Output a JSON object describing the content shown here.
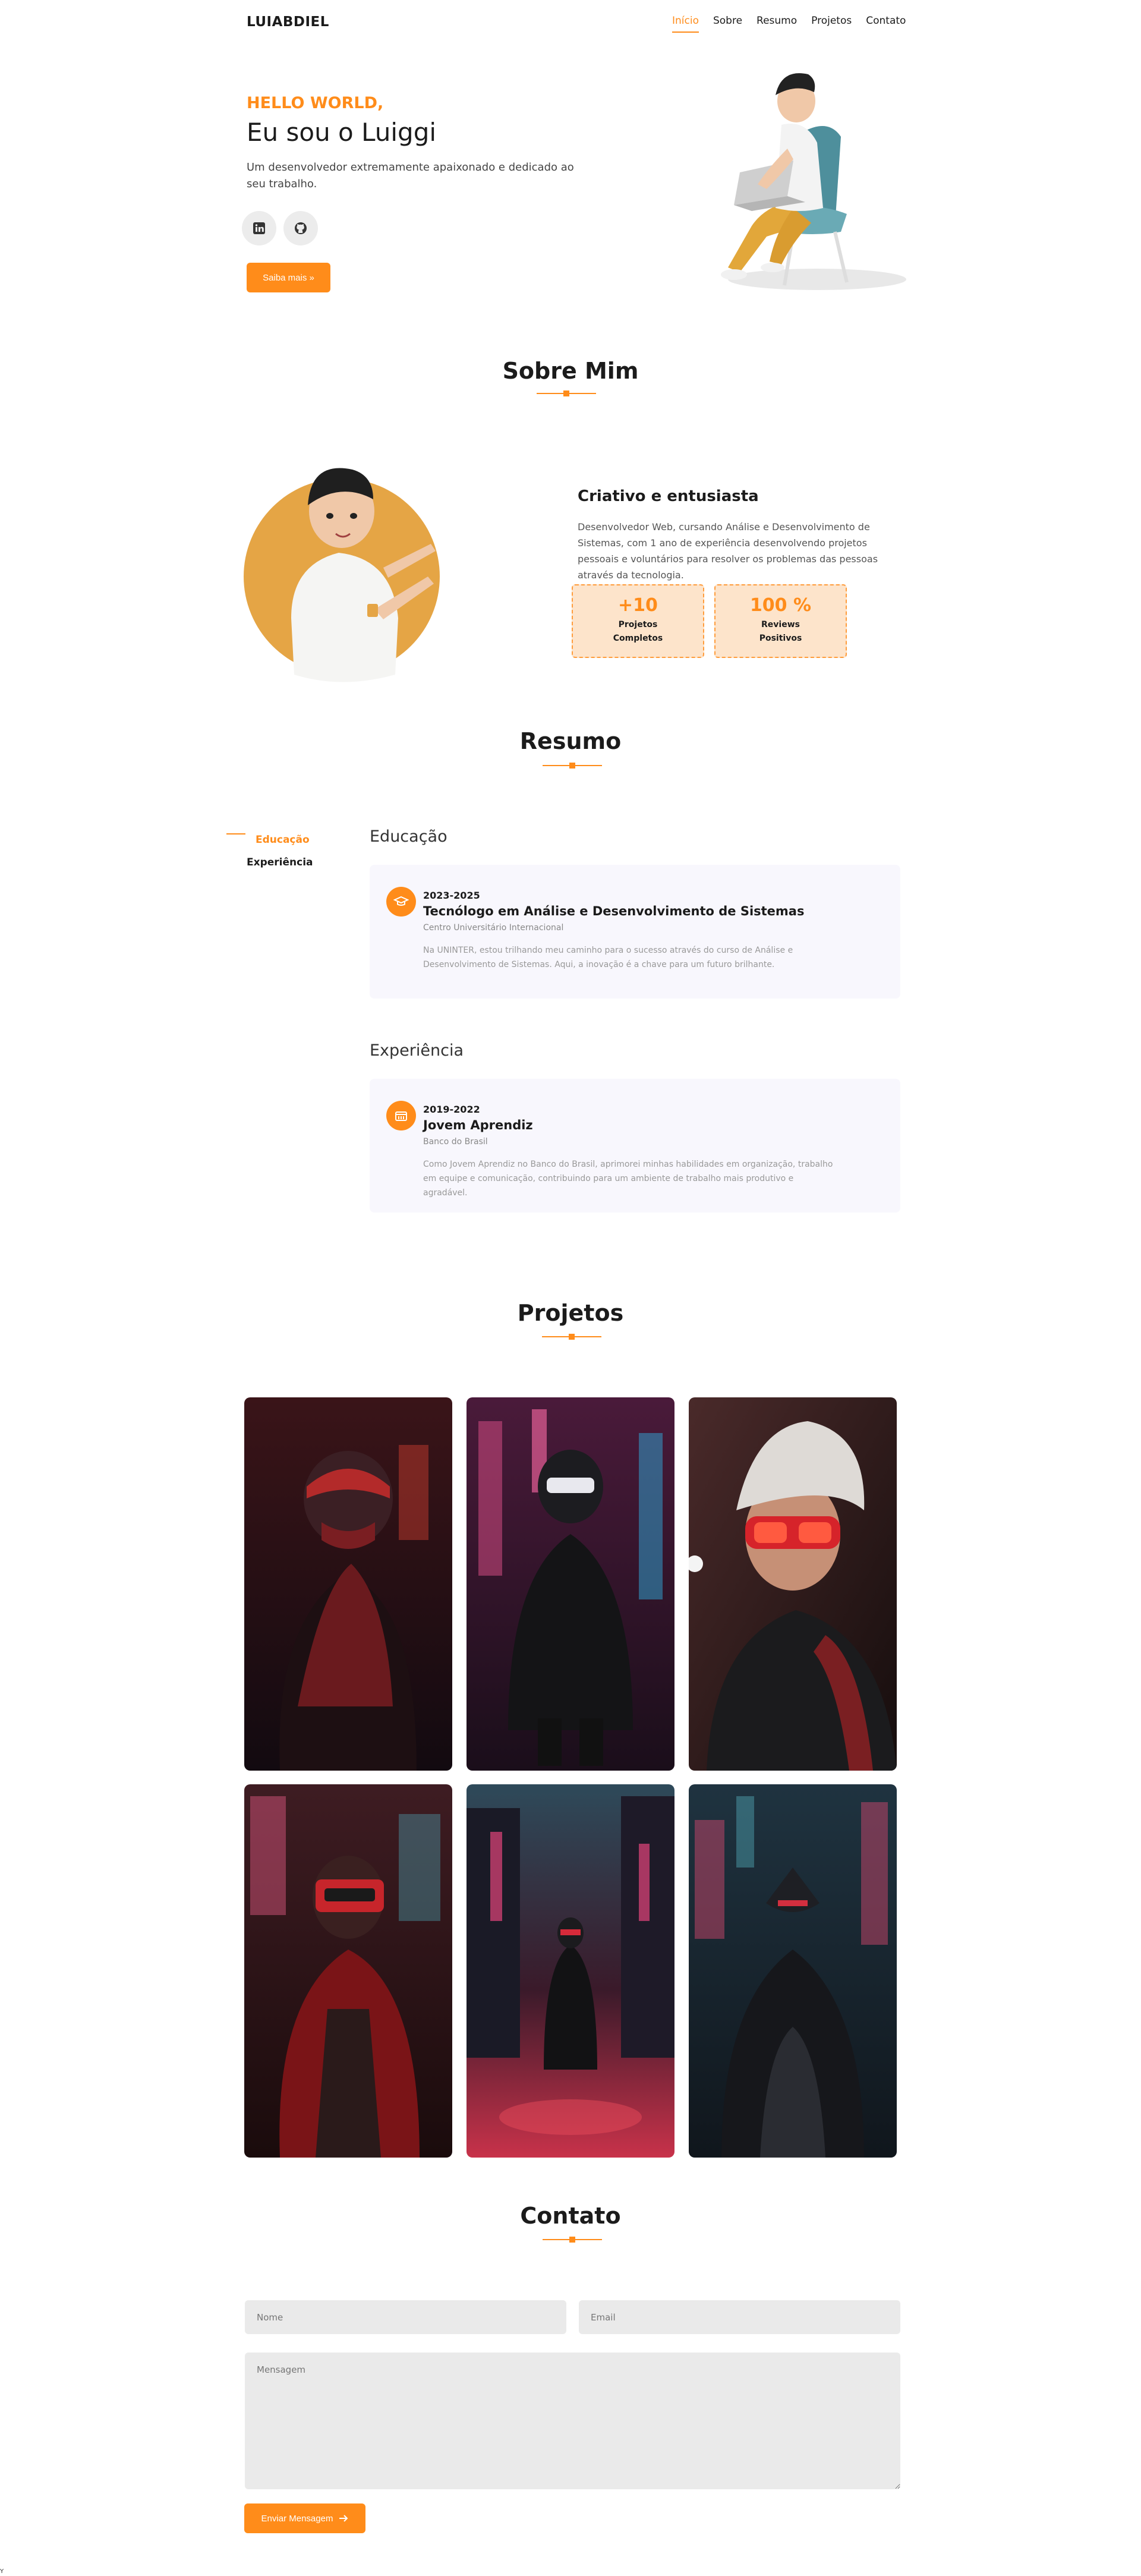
{
  "header": {
    "logo": "LUIABDIEL",
    "nav": [
      "Início",
      "Sobre",
      "Resumo",
      "Projetos",
      "Contato"
    ]
  },
  "hero": {
    "greeting": "HELLO WORLD,",
    "title": "Eu sou o Luiggi",
    "subtitle": "Um desenvolvedor extremamente apaixonado e dedicado ao seu trabalho.",
    "button": "Saiba mais »",
    "social_icons": [
      "linkedin-icon",
      "github-icon"
    ]
  },
  "about": {
    "title": "Sobre Mim",
    "heading": "Criativo e entusiasta",
    "text": "Desenvolvedor Web, cursando Análise e Desenvolvimento de Sistemas, com 1 ano de experiência desenvolvendo projetos pessoais e voluntários para resolver os problemas das pessoas através da tecnologia.",
    "stats": [
      {
        "value": "+10",
        "label1": "Projetos",
        "label2": "Completos"
      },
      {
        "value": "100 %",
        "label1": "Reviews",
        "label2": "Positivos"
      }
    ]
  },
  "resume": {
    "title": "Resumo",
    "tabs": [
      "Educação",
      "Experiência"
    ],
    "education": {
      "heading": "Educação",
      "date": "2023-2025",
      "title": "Tecnólogo em Análise e Desenvolvimento de Sistemas",
      "org": "Centro Universitário Internacional",
      "desc": "Na UNINTER, estou trilhando meu caminho para o sucesso através do curso de Análise e Desenvolvimento de Sistemas. Aqui, a inovação é a chave para um futuro brilhante."
    },
    "experience": {
      "heading": "Experiência",
      "date": "2019-2022",
      "title": "Jovem Aprendiz",
      "org": "Banco do Brasil",
      "desc": "Como Jovem Aprendiz no Banco do Brasil, aprimorei minhas habilidades em organização, trabalho em equipe e comunicação, contribuindo para um ambiente de trabalho mais produtivo e agradável."
    }
  },
  "projects": {
    "title": "Projetos"
  },
  "contact": {
    "title": "Contato",
    "name_placeholder": "Nome",
    "email_placeholder": "Email",
    "message_placeholder": "Mensagem",
    "button": "Enviar Mensagem"
  },
  "colors": {
    "accent": "#ff8c1a",
    "card_bg": "#f8f7fd",
    "stat_bg": "#fde4cb"
  },
  "corner_text": "Y"
}
